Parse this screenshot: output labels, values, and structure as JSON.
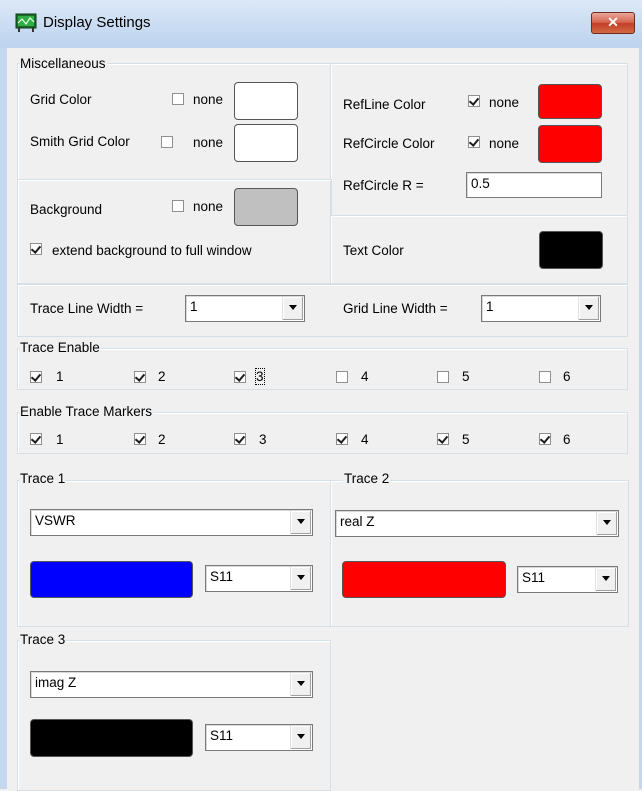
{
  "window": {
    "title": "Display Settings",
    "close_label": "✕"
  },
  "misc": {
    "legend": "Miscellaneous",
    "grid_color_label": "Grid Color",
    "smith_grid_color_label": "Smith Grid Color",
    "none_label": "none",
    "grid_none": false,
    "smith_none": false,
    "grid_color": "#ffffff",
    "smith_color": "#ffffff"
  },
  "ref": {
    "refline_label": "RefLine Color",
    "refcircle_label": "RefCircle Color",
    "refcircle_r_label": "RefCircle R =",
    "refcircle_r_value": "0.5",
    "none_label": "none",
    "refline_color": "#ff0000",
    "refcircle_color": "#ff0000"
  },
  "background": {
    "label": "Background",
    "none_label": "none",
    "color": "#c0c0c0",
    "extend_label": "extend background to full window"
  },
  "text_color": {
    "label": "Text Color",
    "color": "#000000"
  },
  "widths": {
    "trace_label": "Trace Line Width =",
    "trace_value": "1",
    "grid_label": "Grid Line Width =",
    "grid_value": "1"
  },
  "trace_enable": {
    "legend": "Trace Enable",
    "items": [
      "1",
      "2",
      "3",
      "4",
      "5",
      "6"
    ]
  },
  "trace_markers": {
    "legend": "Enable Trace Markers",
    "items": [
      "1",
      "2",
      "3",
      "4",
      "5",
      "6"
    ]
  },
  "traces": [
    {
      "legend": "Trace 1",
      "type": "VSWR",
      "param": "S11",
      "color": "#0000ff"
    },
    {
      "legend": "Trace 2",
      "type": "real Z",
      "param": "S11",
      "color": "#ff0000"
    },
    {
      "legend": "Trace 3",
      "type": "imag Z",
      "param": "S11",
      "color": "#000000"
    }
  ]
}
